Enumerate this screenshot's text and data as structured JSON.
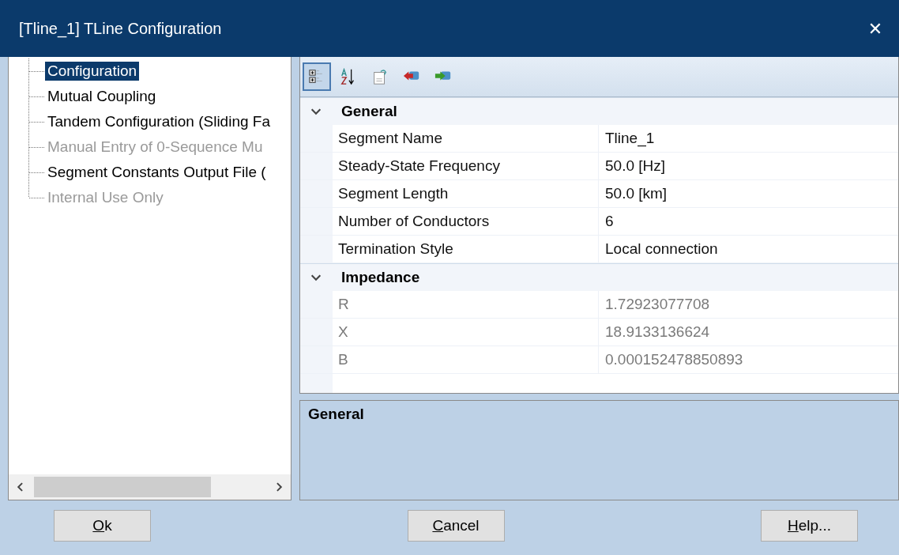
{
  "window": {
    "title": "[Tline_1] TLine Configuration",
    "close": "✕"
  },
  "tree": {
    "items": [
      {
        "label": "Configuration",
        "selected": true,
        "disabled": false
      },
      {
        "label": "Mutual Coupling",
        "selected": false,
        "disabled": false
      },
      {
        "label": "Tandem Configuration (Sliding Fa",
        "selected": false,
        "disabled": false
      },
      {
        "label": "Manual Entry of 0-Sequence Mu",
        "selected": false,
        "disabled": true
      },
      {
        "label": "Segment Constants Output File (",
        "selected": false,
        "disabled": false
      },
      {
        "label": "Internal Use Only",
        "selected": false,
        "disabled": true
      }
    ]
  },
  "toolbar": [
    {
      "kind": "categorized",
      "selected": true
    },
    {
      "kind": "alphabetical",
      "selected": false
    },
    {
      "kind": "pages",
      "selected": false
    },
    {
      "kind": "import",
      "selected": false
    },
    {
      "kind": "export",
      "selected": false
    }
  ],
  "grid": {
    "categories": [
      {
        "name": "General",
        "expanded": true,
        "properties": [
          {
            "name": "Segment Name",
            "value": "Tline_1",
            "read_only": false
          },
          {
            "name": "Steady-State Frequency",
            "value": "50.0 [Hz]",
            "read_only": false
          },
          {
            "name": "Segment Length",
            "value": "50.0 [km]",
            "read_only": false
          },
          {
            "name": "Number of Conductors",
            "value": "6",
            "read_only": false
          },
          {
            "name": "Termination Style",
            "value": "Local connection",
            "read_only": false
          }
        ]
      },
      {
        "name": "Impedance",
        "expanded": true,
        "properties": [
          {
            "name": "R",
            "value": "1.72923077708",
            "read_only": true
          },
          {
            "name": "X",
            "value": "18.9133136624",
            "read_only": true
          },
          {
            "name": "B",
            "value": "0.000152478850893",
            "read_only": true
          }
        ]
      }
    ]
  },
  "description": {
    "title": "General"
  },
  "buttons": [
    {
      "label": "Ok"
    },
    {
      "label": "Cancel"
    },
    {
      "label": "Help..."
    }
  ]
}
